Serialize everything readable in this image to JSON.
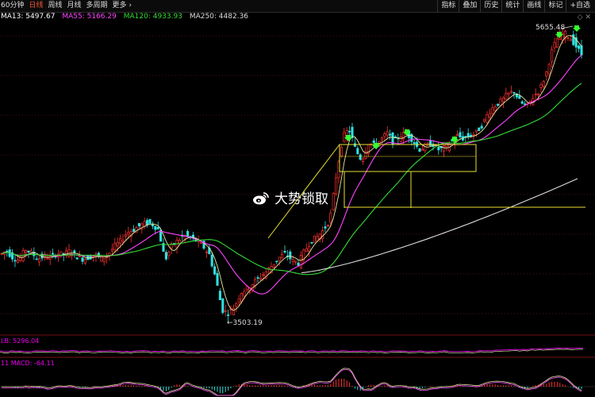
{
  "toolbar": {
    "periods": [
      {
        "label": "60分钟",
        "active": false
      },
      {
        "label": "日线",
        "active": true
      },
      {
        "label": "周线",
        "active": false
      },
      {
        "label": "月线",
        "active": false
      },
      {
        "label": "多周期",
        "active": false
      },
      {
        "label": "更多 ›",
        "active": false
      }
    ],
    "tools": [
      "指标",
      "叠加",
      "历史",
      "统计",
      "画线",
      "标记",
      "+自选"
    ]
  },
  "legend": {
    "ma13": "MA13: 5497.67",
    "ma55": "MA55: 5166.29",
    "ma120": "MA120: 4933.93",
    "ma250": "MA250: 4482.36",
    "lb": "LB: 5296.04",
    "macd_prefix": "11",
    "macd": "MACD: -64.11"
  },
  "colors": {
    "ma13": "#ffffff",
    "ma55": "#ff44ff",
    "ma120": "#33dd33",
    "ma250": "#dddddd",
    "up": "#ff3030",
    "down": "#30e0e0",
    "annotation": "#e8e030",
    "arrow": "#33ff33"
  },
  "watermark": {
    "text": "大势锁取",
    "icon": "weibo-icon"
  },
  "annotations": {
    "high_label": "5655.48",
    "low_label": "←3503.19"
  },
  "chart_data": {
    "type": "candlestick",
    "x_axis": "trading days (unlabeled)",
    "y_range": [
      3480,
      5700
    ],
    "key_points": [
      {
        "label": "low",
        "value": 3503.19
      },
      {
        "label": "high",
        "value": 5655.48
      }
    ],
    "moving_averages": [
      {
        "name": "MA13",
        "last": 5497.67
      },
      {
        "name": "MA55",
        "last": 5166.29
      },
      {
        "name": "MA120",
        "last": 4933.93
      },
      {
        "name": "MA250",
        "last": 4482.36
      }
    ],
    "indicators": [
      {
        "name": "LB",
        "last": 5296.04
      },
      {
        "name": "MACD",
        "last": -64.11
      }
    ],
    "close_path": [
      [
        0,
        4020
      ],
      [
        8,
        4050
      ],
      [
        16,
        4000
      ],
      [
        24,
        3980
      ],
      [
        32,
        4060
      ],
      [
        40,
        4030
      ],
      [
        48,
        3990
      ],
      [
        56,
        4010
      ],
      [
        64,
        4000
      ],
      [
        72,
        4030
      ],
      [
        80,
        4020
      ],
      [
        88,
        4050
      ],
      [
        96,
        4010
      ],
      [
        104,
        3990
      ],
      [
        112,
        4000
      ],
      [
        120,
        4020
      ],
      [
        128,
        3990
      ],
      [
        136,
        4020
      ],
      [
        144,
        4080
      ],
      [
        152,
        4120
      ],
      [
        160,
        4180
      ],
      [
        168,
        4200
      ],
      [
        176,
        4230
      ],
      [
        184,
        4250
      ],
      [
        192,
        4240
      ],
      [
        200,
        4200
      ],
      [
        208,
        3980
      ],
      [
        216,
        4080
      ],
      [
        224,
        4120
      ],
      [
        232,
        4160
      ],
      [
        240,
        4140
      ],
      [
        248,
        4120
      ],
      [
        256,
        4080
      ],
      [
        264,
        4020
      ],
      [
        272,
        3850
      ],
      [
        280,
        3620
      ],
      [
        288,
        3600
      ],
      [
        296,
        3650
      ],
      [
        304,
        3750
      ],
      [
        312,
        3780
      ],
      [
        320,
        3820
      ],
      [
        328,
        3860
      ],
      [
        336,
        3900
      ],
      [
        344,
        3950
      ],
      [
        352,
        4000
      ],
      [
        360,
        4030
      ],
      [
        368,
        3980
      ],
      [
        376,
        3960
      ],
      [
        384,
        4050
      ],
      [
        392,
        4120
      ],
      [
        400,
        4150
      ],
      [
        408,
        4200
      ],
      [
        416,
        4280
      ],
      [
        424,
        4600
      ],
      [
        432,
        4870
      ],
      [
        440,
        4930
      ],
      [
        448,
        4780
      ],
      [
        456,
        4700
      ],
      [
        464,
        4830
      ],
      [
        472,
        4810
      ],
      [
        480,
        4850
      ],
      [
        488,
        4900
      ],
      [
        496,
        4830
      ],
      [
        504,
        4880
      ],
      [
        512,
        4900
      ],
      [
        520,
        4850
      ],
      [
        528,
        4780
      ],
      [
        536,
        4800
      ],
      [
        544,
        4830
      ],
      [
        552,
        4780
      ],
      [
        560,
        4790
      ],
      [
        568,
        4830
      ],
      [
        576,
        4880
      ],
      [
        584,
        4860
      ],
      [
        592,
        4880
      ],
      [
        600,
        4900
      ],
      [
        608,
        4960
      ],
      [
        616,
        5050
      ],
      [
        624,
        5100
      ],
      [
        632,
        5130
      ],
      [
        640,
        5180
      ],
      [
        648,
        5200
      ],
      [
        656,
        5120
      ],
      [
        664,
        5090
      ],
      [
        672,
        5160
      ],
      [
        680,
        5210
      ],
      [
        688,
        5320
      ],
      [
        696,
        5500
      ],
      [
        704,
        5600
      ],
      [
        712,
        5620
      ],
      [
        720,
        5580
      ],
      [
        728,
        5510
      ],
      [
        736,
        5440
      ]
    ]
  }
}
